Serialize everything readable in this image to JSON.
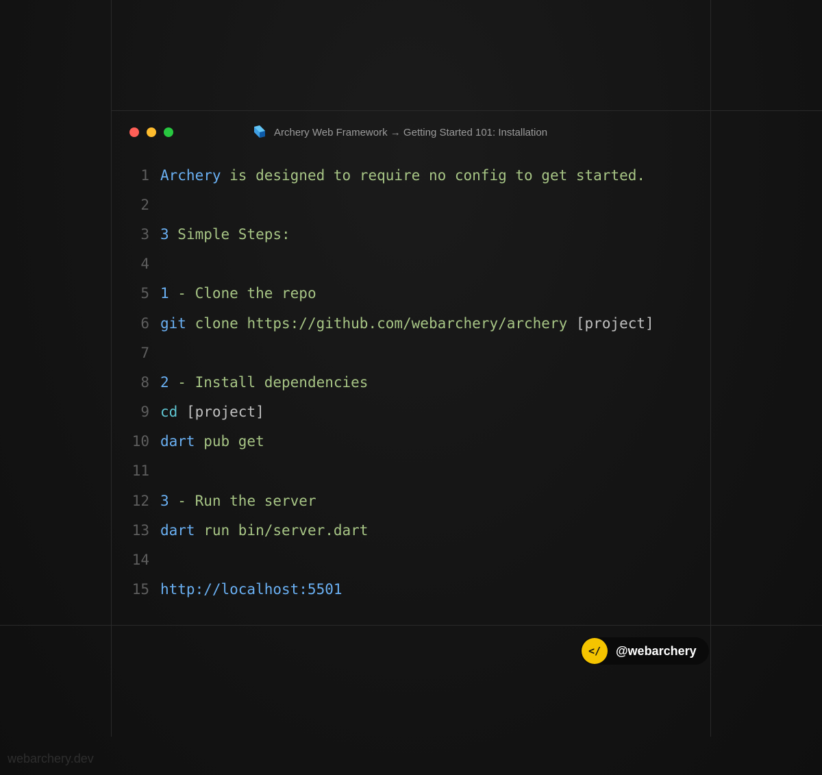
{
  "colors": {
    "dot_red": "#ff5f57",
    "dot_yellow": "#febc2e",
    "dot_green": "#28c840",
    "dart_logo": "#3f9fe3",
    "keyword_blue": "#6ab0f3",
    "string_green": "#a7c585",
    "bracket_gray": "#c0c0c0",
    "command_teal": "#5fc6d2",
    "handle_yellow": "#f5c400"
  },
  "window": {
    "title": "Archery Web Framework → Getting Started 101: Installation",
    "title_icon": "dart-logo-icon"
  },
  "code_lines": [
    {
      "number": "1",
      "tokens": [
        {
          "text": "Archery",
          "style": "blue"
        },
        {
          "text": " is designed to require no config to get started.",
          "style": "green"
        }
      ]
    },
    {
      "number": "2",
      "tokens": []
    },
    {
      "number": "3",
      "tokens": [
        {
          "text": "3",
          "style": "blue"
        },
        {
          "text": " Simple Steps:",
          "style": "green"
        }
      ]
    },
    {
      "number": "4",
      "tokens": []
    },
    {
      "number": "5",
      "tokens": [
        {
          "text": "1",
          "style": "blue"
        },
        {
          "text": " - Clone the repo",
          "style": "green"
        }
      ]
    },
    {
      "number": "6",
      "tokens": [
        {
          "text": "git",
          "style": "blue"
        },
        {
          "text": " clone https://github.com/webarchery/archery ",
          "style": "green"
        },
        {
          "text": "[project]",
          "style": "gray"
        }
      ]
    },
    {
      "number": "7",
      "tokens": []
    },
    {
      "number": "8",
      "tokens": [
        {
          "text": "2",
          "style": "blue"
        },
        {
          "text": " - Install dependencies",
          "style": "green"
        }
      ]
    },
    {
      "number": "9",
      "tokens": [
        {
          "text": "cd",
          "style": "teal"
        },
        {
          "text": " [project]",
          "style": "gray"
        }
      ]
    },
    {
      "number": "10",
      "tokens": [
        {
          "text": "dart",
          "style": "blue"
        },
        {
          "text": " pub get",
          "style": "green"
        }
      ]
    },
    {
      "number": "11",
      "tokens": []
    },
    {
      "number": "12",
      "tokens": [
        {
          "text": "3",
          "style": "blue"
        },
        {
          "text": " - Run the server",
          "style": "green"
        }
      ]
    },
    {
      "number": "13",
      "tokens": [
        {
          "text": "dart",
          "style": "blue"
        },
        {
          "text": " run bin/server.dart",
          "style": "green"
        }
      ]
    },
    {
      "number": "14",
      "tokens": []
    },
    {
      "number": "15",
      "tokens": [
        {
          "text": "http://localhost:5501",
          "style": "blue"
        }
      ]
    }
  ],
  "handle": {
    "logo_text": "</",
    "name": "@webarchery"
  },
  "watermark": "webarchery.dev"
}
